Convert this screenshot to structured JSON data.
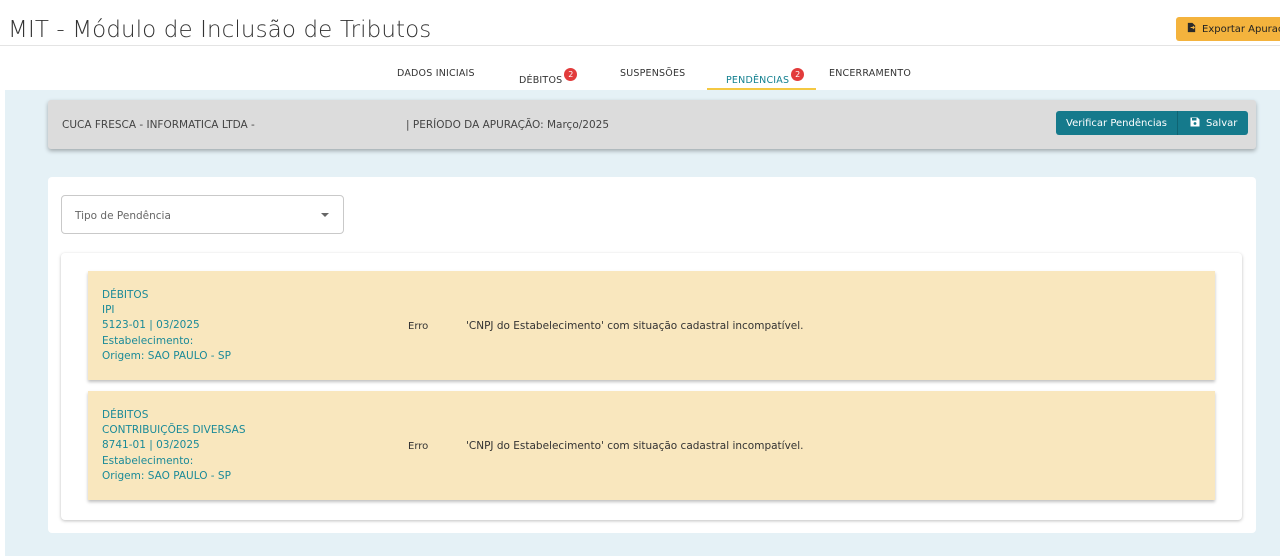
{
  "header": {
    "title": "MIT - Módulo de Inclusão de Tributos",
    "export_label": "Exportar Apuraç",
    "export_icon": "file-export-icon"
  },
  "tabs": [
    {
      "label": "DADOS INICIAIS",
      "badge": null,
      "active": false
    },
    {
      "label": "DÉBITOS",
      "badge": "2",
      "active": false
    },
    {
      "label": "SUSPENSÕES",
      "badge": null,
      "active": false
    },
    {
      "label": "PENDÊNCIAS",
      "badge": "2",
      "active": true
    },
    {
      "label": "ENCERRAMENTO",
      "badge": null,
      "active": false
    }
  ],
  "company_bar": {
    "company": "CUCA FRESCA - INFORMATICA LTDA -",
    "period": "|  PERÍODO DA APURAÇÃO: Março/2025",
    "verify_label": "Verificar Pendências",
    "save_label": "Salvar",
    "save_icon": "floppy-disk-icon"
  },
  "filter": {
    "placeholder": "Tipo de Pendência"
  },
  "pendencias": [
    {
      "lines": [
        "DÉBITOS",
        "IPI",
        "5123-01 | 03/2025",
        "Estabelecimento:",
        "Origem: SAO PAULO - SP"
      ],
      "status": "Erro",
      "message": "'CNPJ do Estabelecimento' com situação cadastral incompatível."
    },
    {
      "lines": [
        "DÉBITOS",
        "CONTRIBUIÇÕES DIVERSAS",
        "8741-01 | 03/2025",
        "Estabelecimento:",
        "Origem: SAO PAULO - SP"
      ],
      "status": "Erro",
      "message": "'CNPJ do Estabelecimento' com situação cadastral incompatível."
    }
  ],
  "colors": {
    "accent": "#157a8c",
    "link_text": "#1a8a98",
    "warning_bg": "#f9e7be",
    "export_button": "#f4b33d",
    "badge": "#e23b3b",
    "active_tab_underline": "#f4c842"
  }
}
